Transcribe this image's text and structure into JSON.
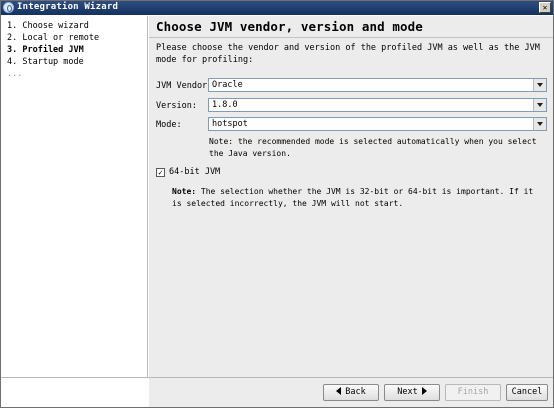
{
  "window": {
    "title": "Integration Wizard",
    "close_glyph": "✕"
  },
  "steps": [
    {
      "label": "1. Choose wizard"
    },
    {
      "label": "2. Local or remote"
    },
    {
      "label": "3. Profiled JVM"
    },
    {
      "label": "4. Startup mode"
    },
    {
      "label": "..."
    }
  ],
  "main": {
    "title": "Choose JVM vendor, version and mode",
    "description": "Please choose the vendor and version of the profiled JVM as well as the JVM mode for profiling:",
    "vendor": {
      "label": "JVM Vendor:",
      "value": "Oracle"
    },
    "version": {
      "label": "Version:",
      "value": "1.8.0"
    },
    "mode": {
      "label": "Mode:",
      "value": "hotspot"
    },
    "mode_note": "Note: the recommended mode is selected automatically when you select the Java version.",
    "bit64": {
      "label": "64-bit JVM",
      "checked": true,
      "check_glyph": "✓"
    },
    "note_label": "Note:",
    "note_text": " The selection whether the JVM is 32-bit or 64-bit is important. If it is selected incorrectly, the JVM will not start."
  },
  "footer": {
    "back_label": "Back",
    "next_label": "Next",
    "finish_label": "Finish",
    "cancel_label": "Cancel"
  }
}
